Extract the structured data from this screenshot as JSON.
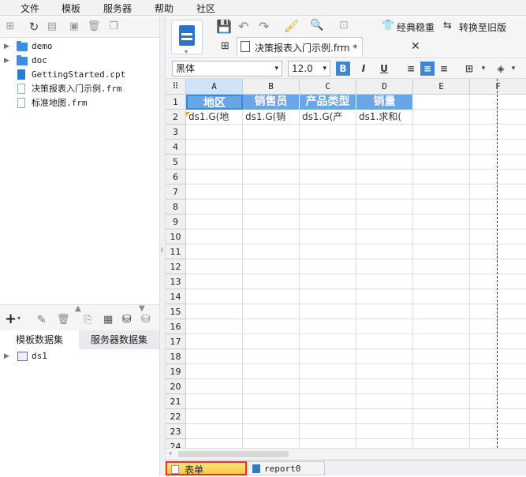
{
  "menu": [
    "文件",
    "模板",
    "服务器",
    "帮助",
    "社区"
  ],
  "tree": [
    {
      "label": "demo",
      "type": "folder",
      "expand": true
    },
    {
      "label": "doc",
      "type": "folder",
      "expand": true
    },
    {
      "label": "GettingStarted.cpt",
      "type": "cpt",
      "expand": false
    },
    {
      "label": "决策报表入门示例.frm",
      "type": "frm",
      "expand": false
    },
    {
      "label": "标准地图.frm",
      "type": "frm",
      "expand": false
    }
  ],
  "dataset_tabs": {
    "template": "模板数据集",
    "server": "服务器数据集"
  },
  "datasets": [
    "ds1"
  ],
  "toolbar": {
    "classic": "经典稳重",
    "convert": "转换至旧版"
  },
  "doc_tab": {
    "title": "决策报表入门示例.frm *"
  },
  "format": {
    "font": "黑体",
    "size": "12.0"
  },
  "columns": [
    "A",
    "B",
    "C",
    "D",
    "E",
    "F"
  ],
  "rows": [
    "1",
    "2",
    "3",
    "4",
    "5",
    "6",
    "7",
    "8",
    "9",
    "10",
    "11",
    "12",
    "13",
    "14",
    "15",
    "16",
    "17",
    "18",
    "19",
    "20",
    "21",
    "22",
    "23",
    "24"
  ],
  "header_cells": [
    "地区",
    "销售员",
    "产品类型",
    "销量"
  ],
  "data_cells": [
    "ds1.G(地",
    "ds1.G(销",
    "ds1.G(产",
    "ds1.求和("
  ],
  "sheets": {
    "form": "表单",
    "report": "report0"
  }
}
